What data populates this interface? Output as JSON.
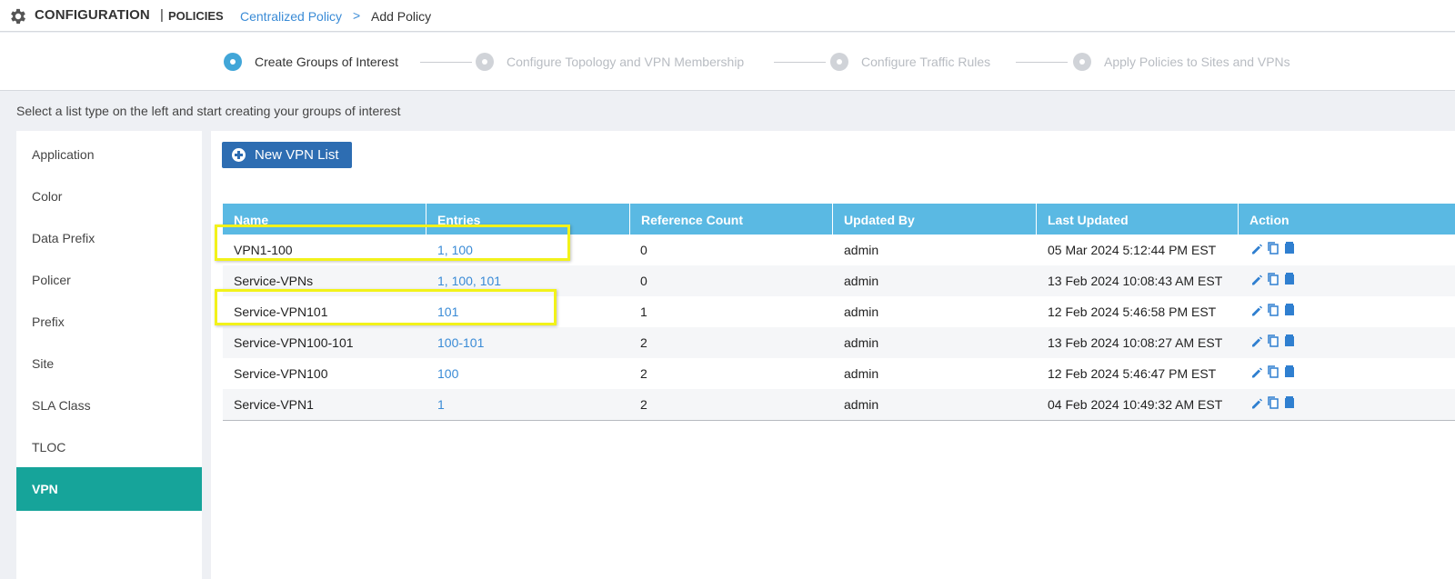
{
  "header": {
    "title": "CONFIGURATION",
    "separator": "|",
    "subtitle": "POLICIES",
    "breadcrumb_link": "Centralized Policy",
    "breadcrumb_separator": ">",
    "breadcrumb_current": "Add Policy"
  },
  "steps": [
    {
      "label": "Create Groups of Interest",
      "active": true
    },
    {
      "label": "Configure Topology and VPN Membership",
      "active": false
    },
    {
      "label": "Configure Traffic Rules",
      "active": false
    },
    {
      "label": "Apply Policies to Sites and VPNs",
      "active": false
    }
  ],
  "hint": "Select a list type on the left and start creating your groups of interest",
  "sidebar": {
    "items": [
      {
        "label": "Application"
      },
      {
        "label": "Color"
      },
      {
        "label": "Data Prefix"
      },
      {
        "label": "Policer"
      },
      {
        "label": "Prefix"
      },
      {
        "label": "Site"
      },
      {
        "label": "SLA Class"
      },
      {
        "label": "TLOC"
      },
      {
        "label": "VPN"
      }
    ],
    "selected": "VPN"
  },
  "toolbar": {
    "new_label": "New VPN List"
  },
  "table": {
    "columns": [
      "Name",
      "Entries",
      "Reference Count",
      "Updated By",
      "Last Updated",
      "Action"
    ],
    "rows": [
      {
        "name": "VPN1-100",
        "entries": "1, 100",
        "ref": "0",
        "by": "admin",
        "updated": "05 Mar 2024 5:12:44 PM EST"
      },
      {
        "name": "Service-VPNs",
        "entries": "1, 100, 101",
        "ref": "0",
        "by": "admin",
        "updated": "13 Feb 2024 10:08:43 AM EST"
      },
      {
        "name": "Service-VPN101",
        "entries": "101",
        "ref": "1",
        "by": "admin",
        "updated": "12 Feb 2024 5:46:58 PM EST"
      },
      {
        "name": "Service-VPN100-101",
        "entries": "100-101",
        "ref": "2",
        "by": "admin",
        "updated": "13 Feb 2024 10:08:27 AM EST"
      },
      {
        "name": "Service-VPN100",
        "entries": "100",
        "ref": "2",
        "by": "admin",
        "updated": "12 Feb 2024 5:46:47 PM EST"
      },
      {
        "name": "Service-VPN1",
        "entries": "1",
        "ref": "2",
        "by": "admin",
        "updated": "04 Feb 2024 10:49:32 AM EST"
      }
    ],
    "action_icons": [
      "edit-icon",
      "copy-icon",
      "delete-icon"
    ]
  },
  "colors": {
    "accent_blue": "#5ab9e3",
    "link_blue": "#3a8bd6",
    "button_blue": "#2d6db2",
    "selected_teal": "#16a49a",
    "annotation_yellow": "#f2f21a"
  }
}
